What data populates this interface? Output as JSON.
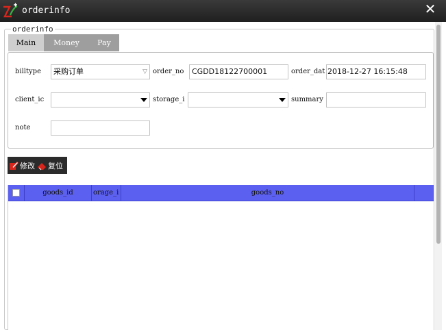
{
  "window": {
    "title": "orderinfo",
    "close_glyph": "✕"
  },
  "group": {
    "label": "orderinfo"
  },
  "tabs": [
    {
      "label": "Main",
      "active": true
    },
    {
      "label": "Money",
      "active": false
    },
    {
      "label": "Pay",
      "active": false
    }
  ],
  "form": {
    "billtype": {
      "label": "billtype",
      "value": "采购订单"
    },
    "order_no": {
      "label": "order_no",
      "value": "CGDD18122700001"
    },
    "order_date": {
      "label": "order_dat",
      "value": "2018-12-27 16:15:48"
    },
    "client_id": {
      "label": "client_ic",
      "value": ""
    },
    "storage_id": {
      "label": "storage_i",
      "value": ""
    },
    "summary": {
      "label": "summary",
      "value": ""
    },
    "note": {
      "label": "note",
      "value": ""
    }
  },
  "toolbar": {
    "edit_label": "修改",
    "reset_label": "复位"
  },
  "grid": {
    "columns": [
      "goods_id",
      "orage_i",
      "goods_no"
    ],
    "rows": []
  },
  "colors": {
    "titlebar": "#2b2b2b",
    "grid_header": "#5c60f0",
    "tab_active": "#cfcfcf",
    "tab_inactive": "#9e9e9e"
  }
}
